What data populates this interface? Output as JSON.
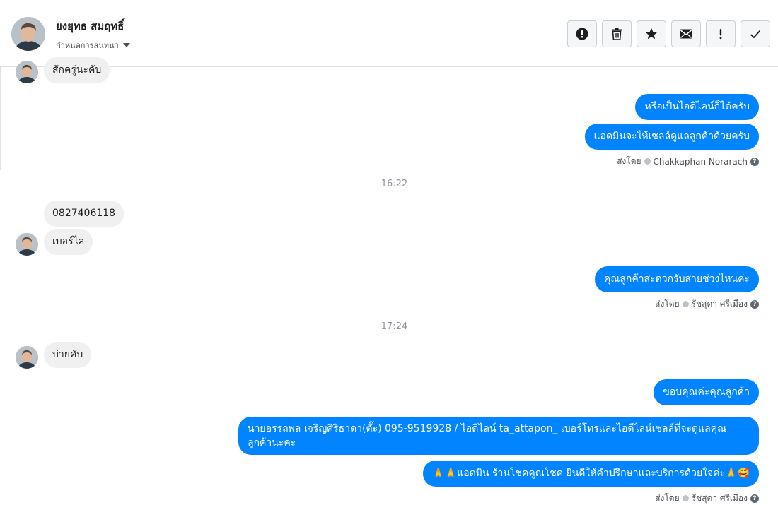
{
  "header": {
    "contact_name": "ยงยุทธ สมฤทธิ์",
    "assign_label": "กำหนดการสนทนา",
    "toolbar": [
      {
        "name": "spam-button",
        "icon": "exclamation-circle-icon"
      },
      {
        "name": "delete-button",
        "icon": "trash-icon"
      },
      {
        "name": "star-button",
        "icon": "star-icon"
      },
      {
        "name": "mark-unread-button",
        "icon": "envelope-icon"
      },
      {
        "name": "follow-up-button",
        "icon": "exclamation-icon"
      },
      {
        "name": "mark-done-button",
        "icon": "check-icon"
      }
    ]
  },
  "messages": {
    "in_0": "สักครู่นะคับ",
    "out_1": "หรือเป็นไอดีไลน์ก็ได้ครับ",
    "out_2": "แอดมินจะให้เซลล์ดูแลลูกค้าด้วยครับ",
    "sent_by_label": "ส่งโดย",
    "agent_1": "Chakkaphan Norarach",
    "time_1": "16:22",
    "in_1": "0827406118",
    "in_2": "เบอร์ไล",
    "out_3": "คุณลูกค้าสะดวกรับสายช่วงไหนค่ะ",
    "agent_2": "รัชสุดา ศรีเมือง",
    "time_2": "17:24",
    "in_3": "บ่ายคับ",
    "out_4": "ขอบคุณค่ะคุณลูกค้า",
    "out_5": "นายอรรถพล เจริญศิริธาดา(ตั๊ะ)      095-9519928 / ไอดีไลน์ ta_attapon_   เบอร์โทรและไอดีไลน์เซลล์ที่จะดูแลคุณลูกค้านะคะ",
    "out_6": "🙏🙏แอดมิน ร้านโชคคูณโชค ยินดีให้คำปรึกษาและบริการด้วยใจค่ะ🙏🥰",
    "agent_3": "รัชสุดา ศรีเมือง"
  },
  "colors": {
    "outgoing_bubble": "#0084ff",
    "incoming_bubble": "#f1f0f0"
  }
}
